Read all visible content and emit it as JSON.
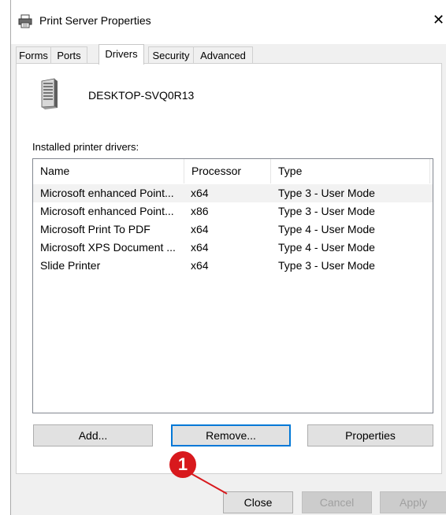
{
  "window": {
    "title": "Print Server Properties",
    "close_glyph": "✕"
  },
  "tabs": [
    {
      "label": "Forms"
    },
    {
      "label": "Ports"
    },
    {
      "label": "Drivers"
    },
    {
      "label": "Security"
    },
    {
      "label": "Advanced"
    }
  ],
  "active_tab": "Drivers",
  "server": {
    "name": "DESKTOP-SVQ0R13",
    "icon": "server-tower-icon"
  },
  "drivers": {
    "section_label": "Installed printer drivers:",
    "columns": [
      "Name",
      "Processor",
      "Type"
    ],
    "rows": [
      {
        "name": "Microsoft enhanced Point...",
        "processor": "x64",
        "type": "Type 3 - User Mode"
      },
      {
        "name": "Microsoft enhanced Point...",
        "processor": "x86",
        "type": "Type 3 - User Mode"
      },
      {
        "name": "Microsoft Print To PDF",
        "processor": "x64",
        "type": "Type 4 - User Mode"
      },
      {
        "name": "Microsoft XPS Document ...",
        "processor": "x64",
        "type": "Type 4 - User Mode"
      },
      {
        "name": "Slide Printer",
        "processor": "x64",
        "type": "Type 3 - User Mode"
      }
    ]
  },
  "buttons": {
    "add": "Add...",
    "remove": "Remove...",
    "properties": "Properties",
    "close": "Close",
    "cancel": "Cancel",
    "apply": "Apply"
  },
  "annotation": {
    "number": "1",
    "color": "#d8191d"
  },
  "colors": {
    "focus_border": "#0078d7",
    "dialog_bg": "#f0f0f0"
  }
}
